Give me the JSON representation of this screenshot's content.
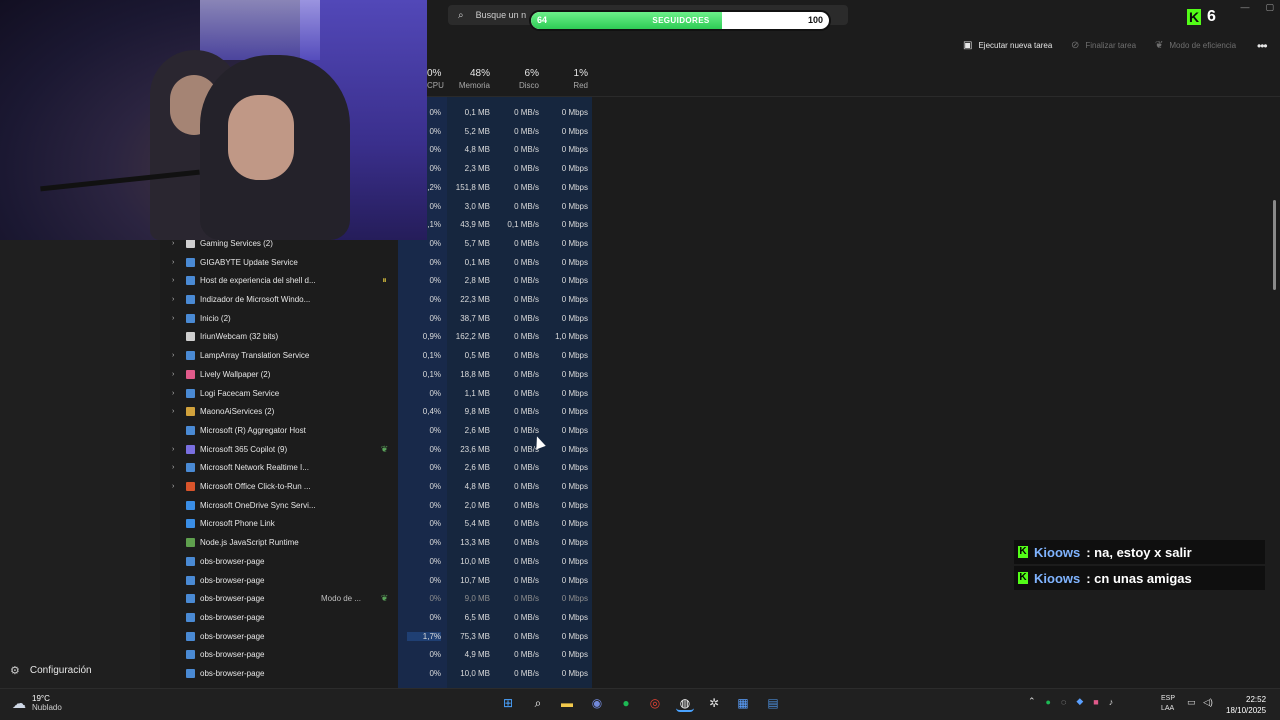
{
  "search": {
    "placeholder": "Busque un n"
  },
  "toolbar": {
    "run_new_task": "Ejecutar nueva tarea",
    "end_task": "Finalizar tarea",
    "efficiency_mode": "Modo de eficiencia"
  },
  "columns": {
    "cpu": {
      "pct": "0%",
      "label": "CPU"
    },
    "memory": {
      "pct": "48%",
      "label": "Memoria"
    },
    "disk": {
      "pct": "6%",
      "label": "Disco"
    },
    "network": {
      "pct": "1%",
      "label": "Red"
    }
  },
  "nav": {
    "settings": "Configuración"
  },
  "rows": [
    {
      "name": "",
      "cpu": "0%",
      "mem": "0,1 MB",
      "disk": "0 MB/s",
      "net": "0 Mbps"
    },
    {
      "name": "",
      "cpu": "0%",
      "mem": "5,2 MB",
      "disk": "0 MB/s",
      "net": "0 Mbps"
    },
    {
      "name": "",
      "cpu": "0%",
      "mem": "4,8 MB",
      "disk": "0 MB/s",
      "net": "0 Mbps"
    },
    {
      "name": "",
      "cpu": "0%",
      "mem": "2,3 MB",
      "disk": "0 MB/s",
      "net": "0 Mbps"
    },
    {
      "name": "",
      "cpu": "0,2%",
      "mem": "151,8 MB",
      "disk": "0 MB/s",
      "net": "0 Mbps"
    },
    {
      "name": "",
      "cpu": "0%",
      "mem": "3,0 MB",
      "disk": "0 MB/s",
      "net": "0 Mbps"
    },
    {
      "name": "",
      "cpu": "0,1%",
      "mem": "43,9 MB",
      "disk": "0,1 MB/s",
      "net": "0 Mbps"
    },
    {
      "name": "Gaming Services (2)",
      "expand": true,
      "icon": "#cfcfcf",
      "cpu": "0%",
      "mem": "5,7 MB",
      "disk": "0 MB/s",
      "net": "0 Mbps"
    },
    {
      "name": "GIGABYTE Update Service",
      "expand": true,
      "icon": "#4a8ad4",
      "cpu": "0%",
      "mem": "0,1 MB",
      "disk": "0 MB/s",
      "net": "0 Mbps"
    },
    {
      "name": "Host de experiencia del shell d...",
      "expand": true,
      "icon": "#4a8ad4",
      "status_icon": "pause",
      "cpu": "0%",
      "mem": "2,8 MB",
      "disk": "0 MB/s",
      "net": "0 Mbps"
    },
    {
      "name": "Indizador de Microsoft Windo...",
      "expand": true,
      "icon": "#4a8ad4",
      "cpu": "0%",
      "mem": "22,3 MB",
      "disk": "0 MB/s",
      "net": "0 Mbps"
    },
    {
      "name": "Inicio (2)",
      "expand": true,
      "icon": "#4a8ad4",
      "cpu": "0%",
      "mem": "38,7 MB",
      "disk": "0 MB/s",
      "net": "0 Mbps"
    },
    {
      "name": "IriunWebcam (32 bits)",
      "expand": false,
      "icon": "#cfcfcf",
      "cpu": "0,9%",
      "mem": "162,2 MB",
      "disk": "0 MB/s",
      "net": "1,0 Mbps"
    },
    {
      "name": "LampArray Translation Service",
      "expand": true,
      "icon": "#4a8ad4",
      "cpu": "0,1%",
      "mem": "0,5 MB",
      "disk": "0 MB/s",
      "net": "0 Mbps"
    },
    {
      "name": "Lively Wallpaper (2)",
      "expand": true,
      "icon": "#e05a8a",
      "cpu": "0,1%",
      "mem": "18,8 MB",
      "disk": "0 MB/s",
      "net": "0 Mbps"
    },
    {
      "name": "Logi Facecam Service",
      "expand": true,
      "icon": "#4a8ad4",
      "cpu": "0%",
      "mem": "1,1 MB",
      "disk": "0 MB/s",
      "net": "0 Mbps"
    },
    {
      "name": "MaonoAiServices (2)",
      "expand": true,
      "icon": "#d1a23c",
      "cpu": "0,4%",
      "mem": "9,8 MB",
      "disk": "0 MB/s",
      "net": "0 Mbps"
    },
    {
      "name": "Microsoft (R) Aggregator Host",
      "expand": false,
      "icon": "#4a8ad4",
      "cpu": "0%",
      "mem": "2,6 MB",
      "disk": "0 MB/s",
      "net": "0 Mbps"
    },
    {
      "name": "Microsoft 365 Copilot (9)",
      "expand": true,
      "icon": "#7a6fe0",
      "status_icon": "leaf",
      "cpu": "0%",
      "mem": "23,6 MB",
      "disk": "0 MB/s",
      "net": "0 Mbps"
    },
    {
      "name": "Microsoft Network Realtime I...",
      "expand": true,
      "icon": "#4a8ad4",
      "cpu": "0%",
      "mem": "2,6 MB",
      "disk": "0 MB/s",
      "net": "0 Mbps"
    },
    {
      "name": "Microsoft Office Click-to-Run ...",
      "expand": true,
      "icon": "#d9542b",
      "cpu": "0%",
      "mem": "4,8 MB",
      "disk": "0 MB/s",
      "net": "0 Mbps"
    },
    {
      "name": "Microsoft OneDrive Sync Servi...",
      "expand": false,
      "icon": "#3a8ee6",
      "cpu": "0%",
      "mem": "2,0 MB",
      "disk": "0 MB/s",
      "net": "0 Mbps"
    },
    {
      "name": "Microsoft Phone Link",
      "expand": false,
      "icon": "#3a8ee6",
      "cpu": "0%",
      "mem": "5,4 MB",
      "disk": "0 MB/s",
      "net": "0 Mbps"
    },
    {
      "name": "Node.js JavaScript Runtime",
      "expand": false,
      "icon": "#5fa04e",
      "cpu": "0%",
      "mem": "13,3 MB",
      "disk": "0 MB/s",
      "net": "0 Mbps"
    },
    {
      "name": "obs-browser-page",
      "expand": false,
      "icon": "#4a8ad4",
      "cpu": "0%",
      "mem": "10,0 MB",
      "disk": "0 MB/s",
      "net": "0 Mbps"
    },
    {
      "name": "obs-browser-page",
      "expand": false,
      "icon": "#4a8ad4",
      "cpu": "0%",
      "mem": "10,7 MB",
      "disk": "0 MB/s",
      "net": "0 Mbps"
    },
    {
      "name": "obs-browser-page",
      "expand": false,
      "icon": "#4a8ad4",
      "status": "Modo de ...",
      "status_icon": "leaf",
      "faded": true,
      "cpu": "0%",
      "mem": "9,0 MB",
      "disk": "0 MB/s",
      "net": "0 Mbps"
    },
    {
      "name": "obs-browser-page",
      "expand": false,
      "icon": "#4a8ad4",
      "cpu": "0%",
      "mem": "6,5 MB",
      "disk": "0 MB/s",
      "net": "0 Mbps"
    },
    {
      "name": "obs-browser-page",
      "expand": false,
      "icon": "#4a8ad4",
      "hl": true,
      "cpu": "1,7%",
      "mem": "75,3 MB",
      "disk": "0 MB/s",
      "net": "0 Mbps"
    },
    {
      "name": "obs-browser-page",
      "expand": false,
      "icon": "#4a8ad4",
      "cpu": "0%",
      "mem": "4,9 MB",
      "disk": "0 MB/s",
      "net": "0 Mbps"
    },
    {
      "name": "obs-browser-page",
      "expand": false,
      "icon": "#4a8ad4",
      "cpu": "0%",
      "mem": "10,0 MB",
      "disk": "0 MB/s",
      "net": "0 Mbps"
    }
  ],
  "overlay": {
    "follower_goal": {
      "current": "64",
      "label": "SEGUIDORES",
      "max": "100",
      "progress": 0.64
    },
    "viewers": "6",
    "chat": [
      {
        "user": "Kioows",
        "message": ": na, estoy x salir"
      },
      {
        "user": "Kioows",
        "message": ": cn unas amigas"
      }
    ]
  },
  "taskbar": {
    "weather": {
      "temp": "19°C",
      "condition": "Nublado"
    },
    "lang": {
      "line1": "ESP",
      "line2": "LAA"
    },
    "clock": {
      "time": "22:52",
      "date": "18/10/2025"
    }
  },
  "colors": {
    "heatmap": "#16263e",
    "kick_green": "#53fc18",
    "chat_user": "#80b4ff"
  }
}
